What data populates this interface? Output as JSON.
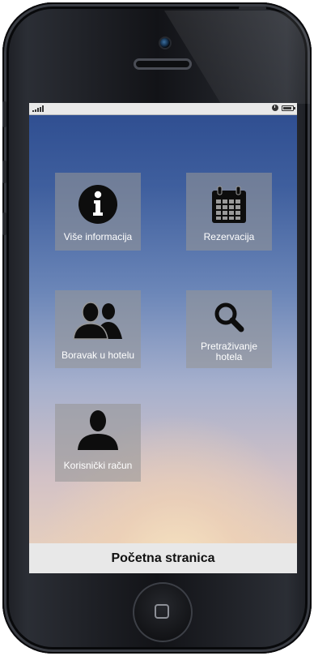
{
  "screen": {
    "title_bar": "Početna stranica",
    "tiles": [
      {
        "label": "Više informacija",
        "icon": "info-icon"
      },
      {
        "label": "Rezervacija",
        "icon": "calendar-icon"
      },
      {
        "label": "Boravak u hotelu",
        "icon": "guests-icon"
      },
      {
        "label": "Pretraživanje hotela",
        "icon": "search-icon"
      },
      {
        "label": "Korisnički račun",
        "icon": "user-icon"
      }
    ]
  },
  "colors": {
    "tile_bg": "#969696",
    "bottom_bar_bg": "#e8e8e8",
    "phone_body": "#15171b"
  }
}
